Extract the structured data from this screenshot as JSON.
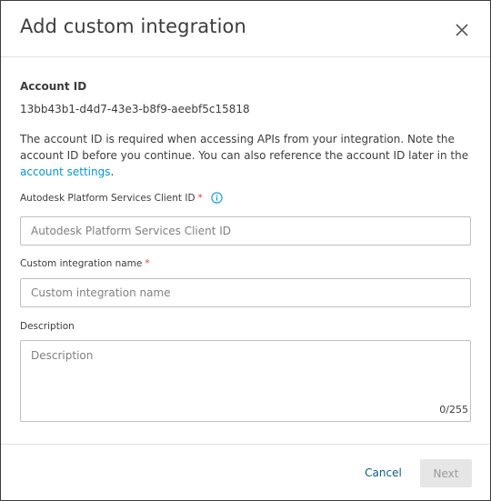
{
  "dialog": {
    "title": "Add custom integration",
    "close_icon": "close-icon"
  },
  "account": {
    "label": "Account ID",
    "id_value": "13bb43b1-d4d7-43e3-b8f9-aeebf5c15818",
    "note_text": "The account ID is required when accessing APIs from your integration. Note the account ID before you continue. You can also reference the account ID later in the ",
    "settings_link": "account settings",
    "note_end": "."
  },
  "fields": {
    "client_id": {
      "label": "Autodesk Platform Services Client ID",
      "required_mark": "*",
      "info_icon": "info-icon",
      "placeholder": "Autodesk Platform Services Client ID",
      "value": ""
    },
    "name": {
      "label": "Custom integration name",
      "required_mark": "*",
      "placeholder": "Custom integration name",
      "value": ""
    },
    "description": {
      "label": "Description",
      "placeholder": "Description",
      "value": "",
      "counter": "0/255"
    }
  },
  "footer": {
    "cancel_label": "Cancel",
    "next_label": "Next"
  },
  "colors": {
    "link": "#0696d7",
    "required": "#e03c3c",
    "disabled_button_bg": "#e6e6e6"
  }
}
